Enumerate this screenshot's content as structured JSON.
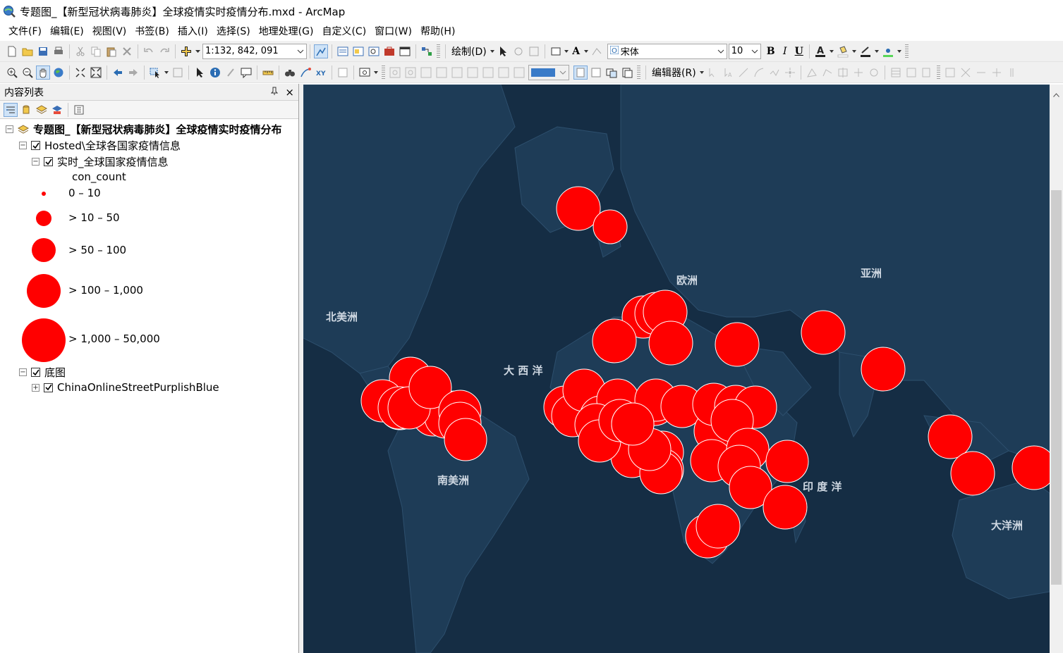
{
  "window": {
    "title": "专题图_【新型冠状病毒肺炎】全球疫情实时疫情分布.mxd - ArcMap"
  },
  "menu": [
    "文件(F)",
    "编辑(E)",
    "视图(V)",
    "书签(B)",
    "插入(I)",
    "选择(S)",
    "地理处理(G)",
    "自定义(C)",
    "窗口(W)",
    "帮助(H)"
  ],
  "toolbar": {
    "scale": "1:132, 842, 091",
    "draw_label": "绘制(D)",
    "font_name": "宋体",
    "font_size": "10",
    "bold": "B",
    "italic": "I",
    "underline": "U",
    "text_tool": "A",
    "editor_label": "编辑器(R)"
  },
  "toc": {
    "title": "内容列表",
    "pin": "ᵠ",
    "close": "×",
    "dataframe": "专题图_【新型冠状病毒肺炎】全球疫情实时疫情分布",
    "group1": "Hosted\\全球各国家疫情信息",
    "layer1": "实时_全球国家疫情信息",
    "field": "con_count",
    "legend": [
      "0 – 10",
      "> 10 – 50",
      "> 50 – 100",
      "> 100 – 1,000",
      "> 1,000 – 50,000"
    ],
    "group2": "底图",
    "basemap": "ChinaOnlineStreetPurplishBlue"
  },
  "map": {
    "labels": {
      "north_america": "北美洲",
      "europe": "欧洲",
      "asia": "亚洲",
      "atlantic": "大 西 洋",
      "south_america": "南美洲",
      "indian_ocean": "印 度 洋",
      "oceania": "大洋洲"
    },
    "point_color": "#ff0000",
    "ocean_color": "#152d44",
    "land_color": "#1e3c57"
  }
}
